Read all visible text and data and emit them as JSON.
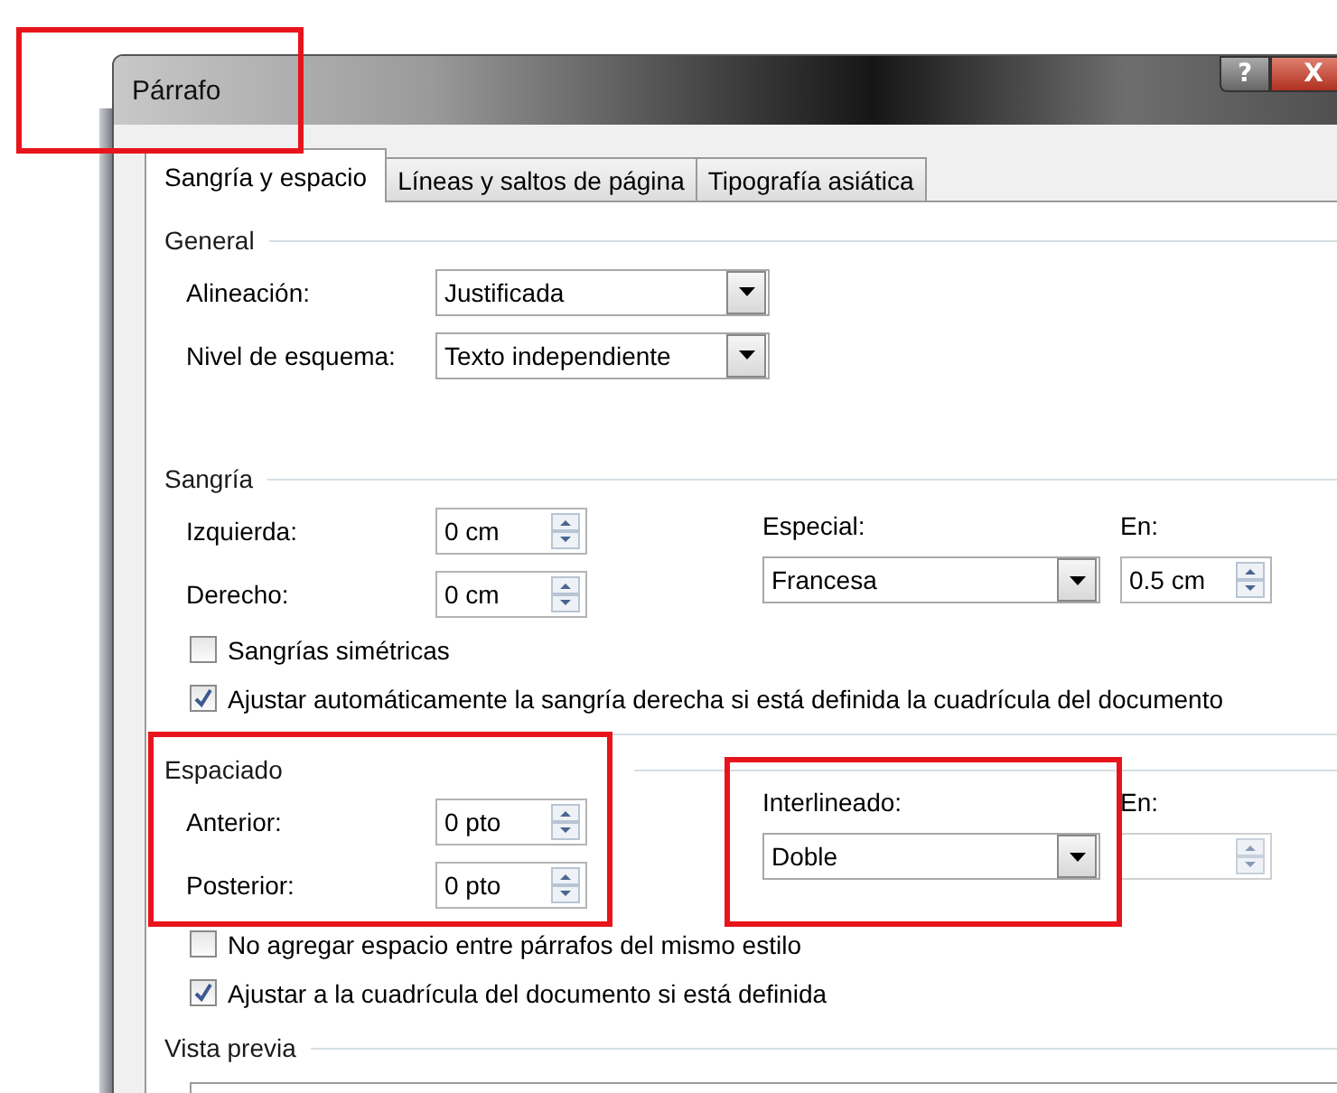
{
  "window": {
    "title": "Párrafo",
    "highlighted": true,
    "help_button": "?",
    "close_button": "X"
  },
  "tabs": [
    {
      "label": "Sangría y espacio",
      "selected": true
    },
    {
      "label": "Líneas y saltos de página",
      "selected": false
    },
    {
      "label": "Tipografía asiática",
      "selected": false
    }
  ],
  "general": {
    "title": "General",
    "fields": [
      {
        "label": "Alineación:",
        "value": "Justificada"
      },
      {
        "label": "Nivel de esquema:",
        "value": "Texto independiente"
      }
    ]
  },
  "sangria": {
    "title": "Sangría",
    "fields": [
      {
        "label": "Izquierda:",
        "value": "0 cm"
      },
      {
        "label": "Derecho:",
        "value": "0 cm"
      }
    ],
    "especial": {
      "label": "Especial:",
      "value": "Francesa"
    },
    "en": {
      "label": "En:",
      "value": "0.5 cm",
      "disabled": false
    },
    "checkboxes": [
      {
        "label": "Sangrías simétricas",
        "checked": false
      },
      {
        "label": "Ajustar automáticamente la sangría derecha si está definida la cuadrícula del documento",
        "checked": true
      }
    ]
  },
  "espaciado": {
    "title": "Espaciado",
    "highlighted": true,
    "fields": [
      {
        "label": "Anterior:",
        "value": "0 pto"
      },
      {
        "label": "Posterior:",
        "value": "0 pto"
      }
    ],
    "interlineado": {
      "label": "Interlineado:",
      "value": "Doble",
      "highlighted": true
    },
    "en": {
      "label": "En:",
      "disabled": true
    },
    "checkboxes": [
      {
        "label": "No agregar espacio entre párrafos del mismo estilo",
        "checked": false
      },
      {
        "label": "Ajustar a la cuadrícula del documento si está definida",
        "checked": true
      }
    ]
  },
  "vista_previa": {
    "title": "Vista previa"
  }
}
